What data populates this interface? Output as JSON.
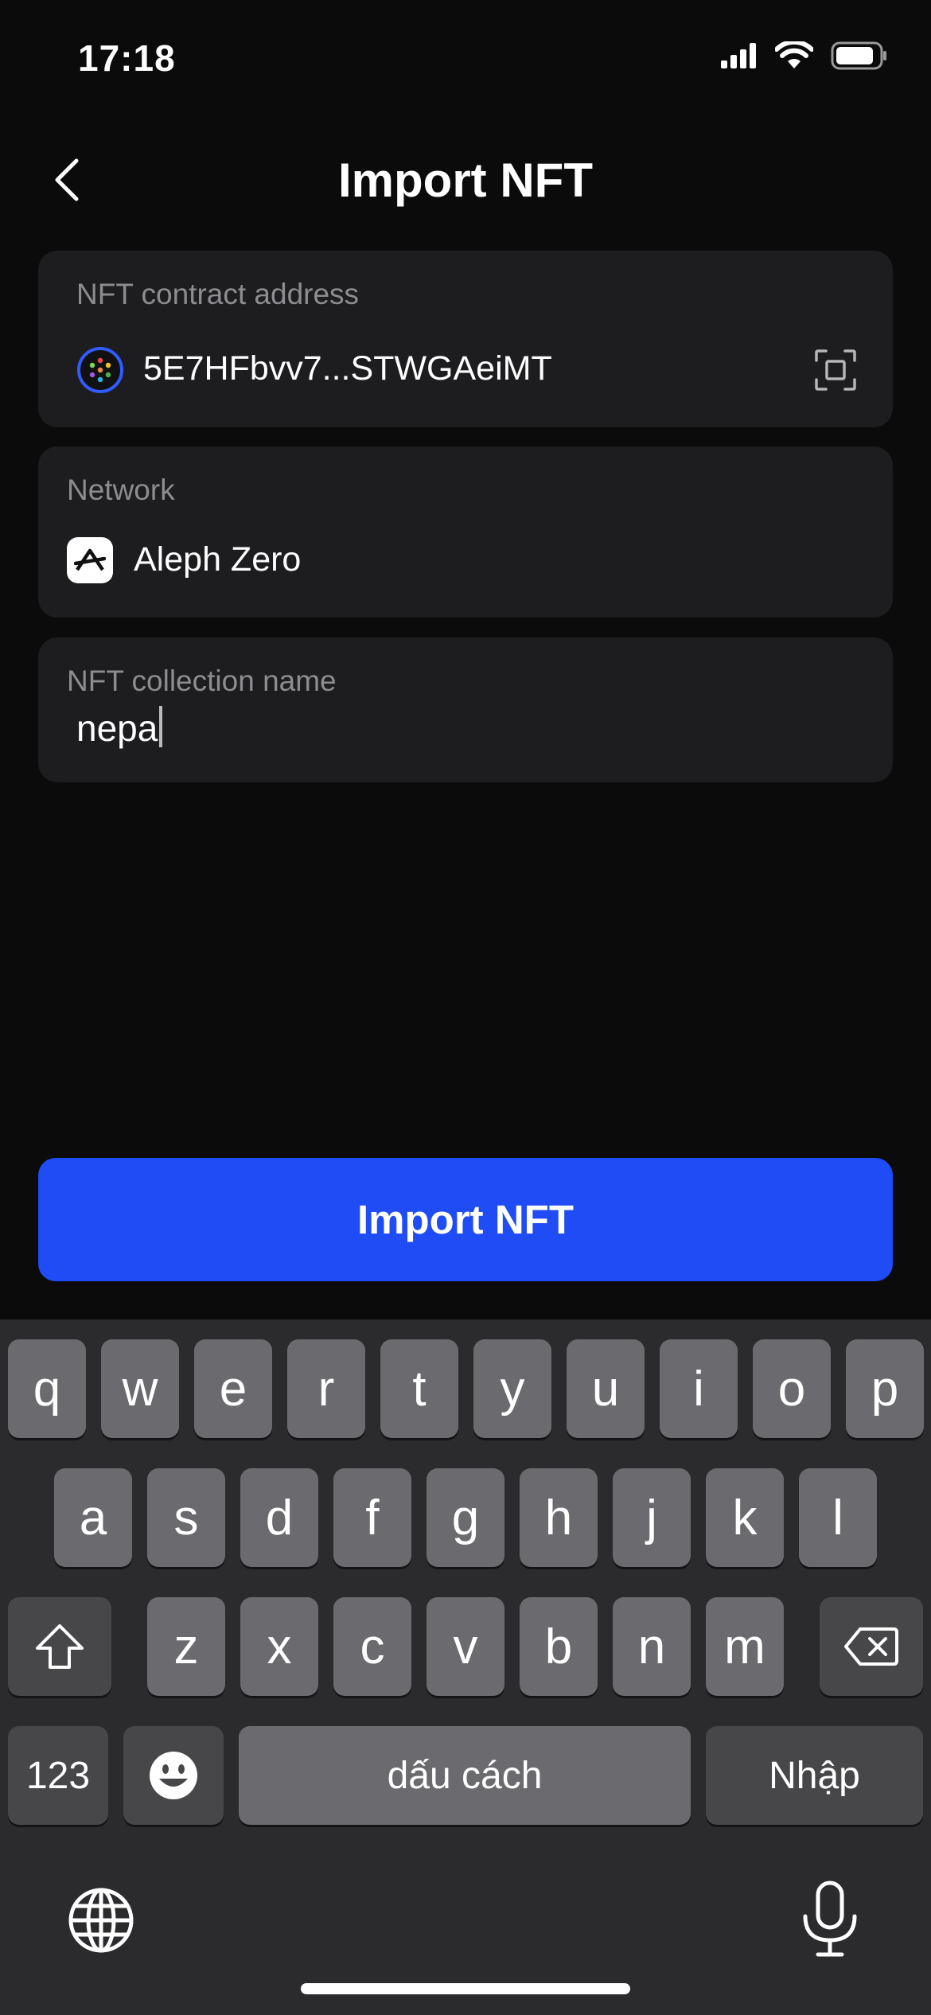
{
  "status": {
    "time": "17:18"
  },
  "header": {
    "title": "Import NFT"
  },
  "contract": {
    "label": "NFT contract address",
    "value": "5E7HFbvv7...STWGAeiMT"
  },
  "network": {
    "label": "Network",
    "name": "Aleph Zero"
  },
  "collection": {
    "label": "NFT collection name",
    "value": "nepa"
  },
  "import_button": {
    "label": "Import NFT"
  },
  "keyboard": {
    "row1": [
      "q",
      "w",
      "e",
      "r",
      "t",
      "y",
      "u",
      "i",
      "o",
      "p"
    ],
    "row2": [
      "a",
      "s",
      "d",
      "f",
      "g",
      "h",
      "j",
      "k",
      "l"
    ],
    "row3": [
      "z",
      "x",
      "c",
      "v",
      "b",
      "n",
      "m"
    ],
    "numbers_label": "123",
    "space_label": "dấu cách",
    "return_label": "Nhập"
  },
  "colors": {
    "accent": "#1f4cf5",
    "background": "#0b0b0c",
    "card": "#1d1d1f"
  }
}
